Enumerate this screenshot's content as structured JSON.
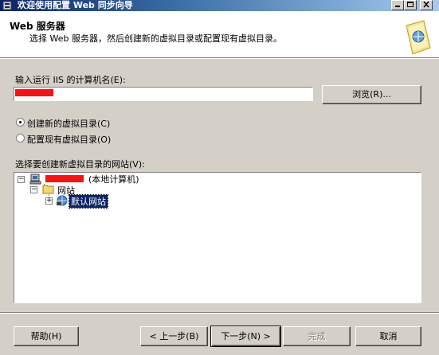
{
  "window": {
    "title": "欢迎使用配置 Web 同步向导",
    "controls": [
      "minimize",
      "maximize",
      "close"
    ]
  },
  "header": {
    "title": "Web 服务器",
    "subtitle": "选择 Web 服务器，然后创建新的虚拟目录或配置现有虚拟目录。"
  },
  "computer": {
    "label": "输入运行 IIS 的计算机名(E):",
    "value": "",
    "browse_label": "浏览(R)..."
  },
  "options": [
    {
      "label": "创建新的虚拟目录(C)",
      "selected": true
    },
    {
      "label": "配置现有虚拟目录(O)",
      "selected": false
    }
  ],
  "tree": {
    "label": "选择要创建新虚拟目录的网站(V):",
    "root_suffix": "(本地计算机)",
    "folder": "网站",
    "site": "默认网站"
  },
  "footer": {
    "help": "帮助(H)",
    "back": "< 上一步(B)",
    "next": "下一步(N) >",
    "finish": "完成",
    "cancel": "取消"
  },
  "colors": {
    "titlebar_start": "#0a246a",
    "selection": "#0a246a",
    "redaction": "#ff1010"
  }
}
